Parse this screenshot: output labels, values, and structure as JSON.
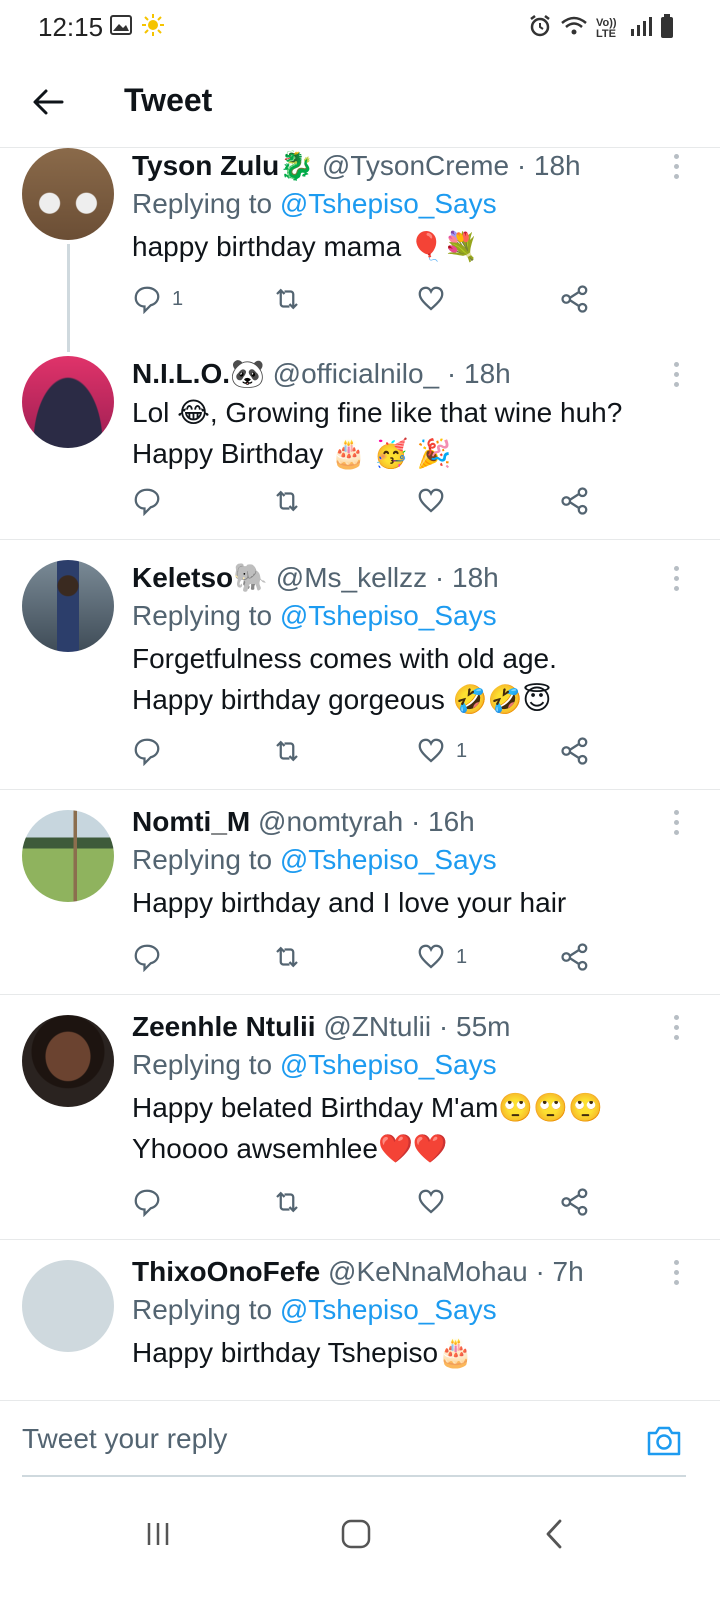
{
  "status_bar": {
    "time": "12:15",
    "network_label": "Vo)) LTE"
  },
  "header": {
    "title": "Tweet"
  },
  "tweets": [
    {
      "name": "Tyson Zulu🐉",
      "handle": "@TysonCreme",
      "time": "· 18h",
      "replying_prefix": "Replying to",
      "replying_to": "@Tshepiso_Says",
      "text": "happy birthday mama 🎈💐",
      "reply_count": "1",
      "like_count": ""
    },
    {
      "name": "N.I.L.O.🐼",
      "handle": "@officialnilo_",
      "time": "· 18h",
      "text": "Lol 😂, Growing fine like that wine huh?\nHappy Birthday 🎂 🥳 🎉",
      "reply_count": "",
      "like_count": ""
    },
    {
      "name": "Keletso🐘",
      "handle": "@Ms_kellzz",
      "time": "· 18h",
      "replying_prefix": "Replying to",
      "replying_to": "@Tshepiso_Says",
      "text": "Forgetfulness comes with old age.\nHappy birthday gorgeous 🤣🤣😇",
      "reply_count": "",
      "like_count": "1"
    },
    {
      "name": "Nomti_M",
      "handle": "@nomtyrah",
      "time": "· 16h",
      "replying_prefix": "Replying to",
      "replying_to": "@Tshepiso_Says",
      "text": "Happy birthday and I love your hair",
      "reply_count": "",
      "like_count": "1"
    },
    {
      "name": "Zeenhle Ntulii",
      "handle": "@ZNtulii",
      "time": "· 55m",
      "replying_prefix": "Replying to",
      "replying_to": "@Tshepiso_Says",
      "text": "Happy belated Birthday M'am🙄🙄🙄\nYhoooo awsemhlee❤️❤️",
      "reply_count": "",
      "like_count": ""
    },
    {
      "name": "ThixoOnoFefe",
      "handle": "@KeNnaMohau",
      "time": "· 7h",
      "replying_prefix": "Replying to",
      "replying_to": "@Tshepiso_Says",
      "text": "Happy birthday Tshepiso🎂"
    }
  ],
  "composer": {
    "placeholder": "Tweet your reply"
  },
  "colors": {
    "accent": "#1d9bf0",
    "text": "#0f1419",
    "secondary": "#536471",
    "divider": "#e7e9ea"
  }
}
